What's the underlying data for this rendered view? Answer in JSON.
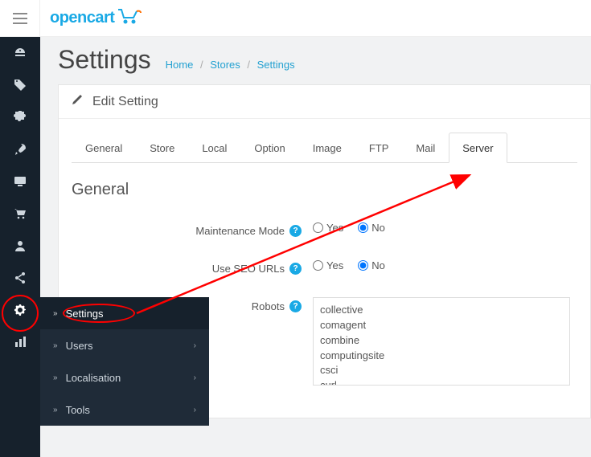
{
  "logo_text": "opencart",
  "page": {
    "title": "Settings"
  },
  "breadcrumbs": {
    "home": "Home",
    "stores": "Stores",
    "settings": "Settings"
  },
  "panel": {
    "title": "Edit Setting"
  },
  "tabs": {
    "general": "General",
    "store": "Store",
    "local": "Local",
    "option": "Option",
    "image": "Image",
    "ftp": "FTP",
    "mail": "Mail",
    "server": "Server"
  },
  "section": {
    "general": "General"
  },
  "fields": {
    "maintenance": {
      "label": "Maintenance Mode",
      "yes": "Yes",
      "no": "No",
      "value": "No"
    },
    "seo": {
      "label": "Use SEO URLs",
      "yes": "Yes",
      "no": "No",
      "value": "No"
    },
    "robots": {
      "label": "Robots",
      "value": "collective\ncomagent\ncombine\ncomputingsite\ncsci\ncurl"
    }
  },
  "flyout": {
    "settings": "Settings",
    "users": "Users",
    "localisation": "Localisation",
    "tools": "Tools"
  }
}
